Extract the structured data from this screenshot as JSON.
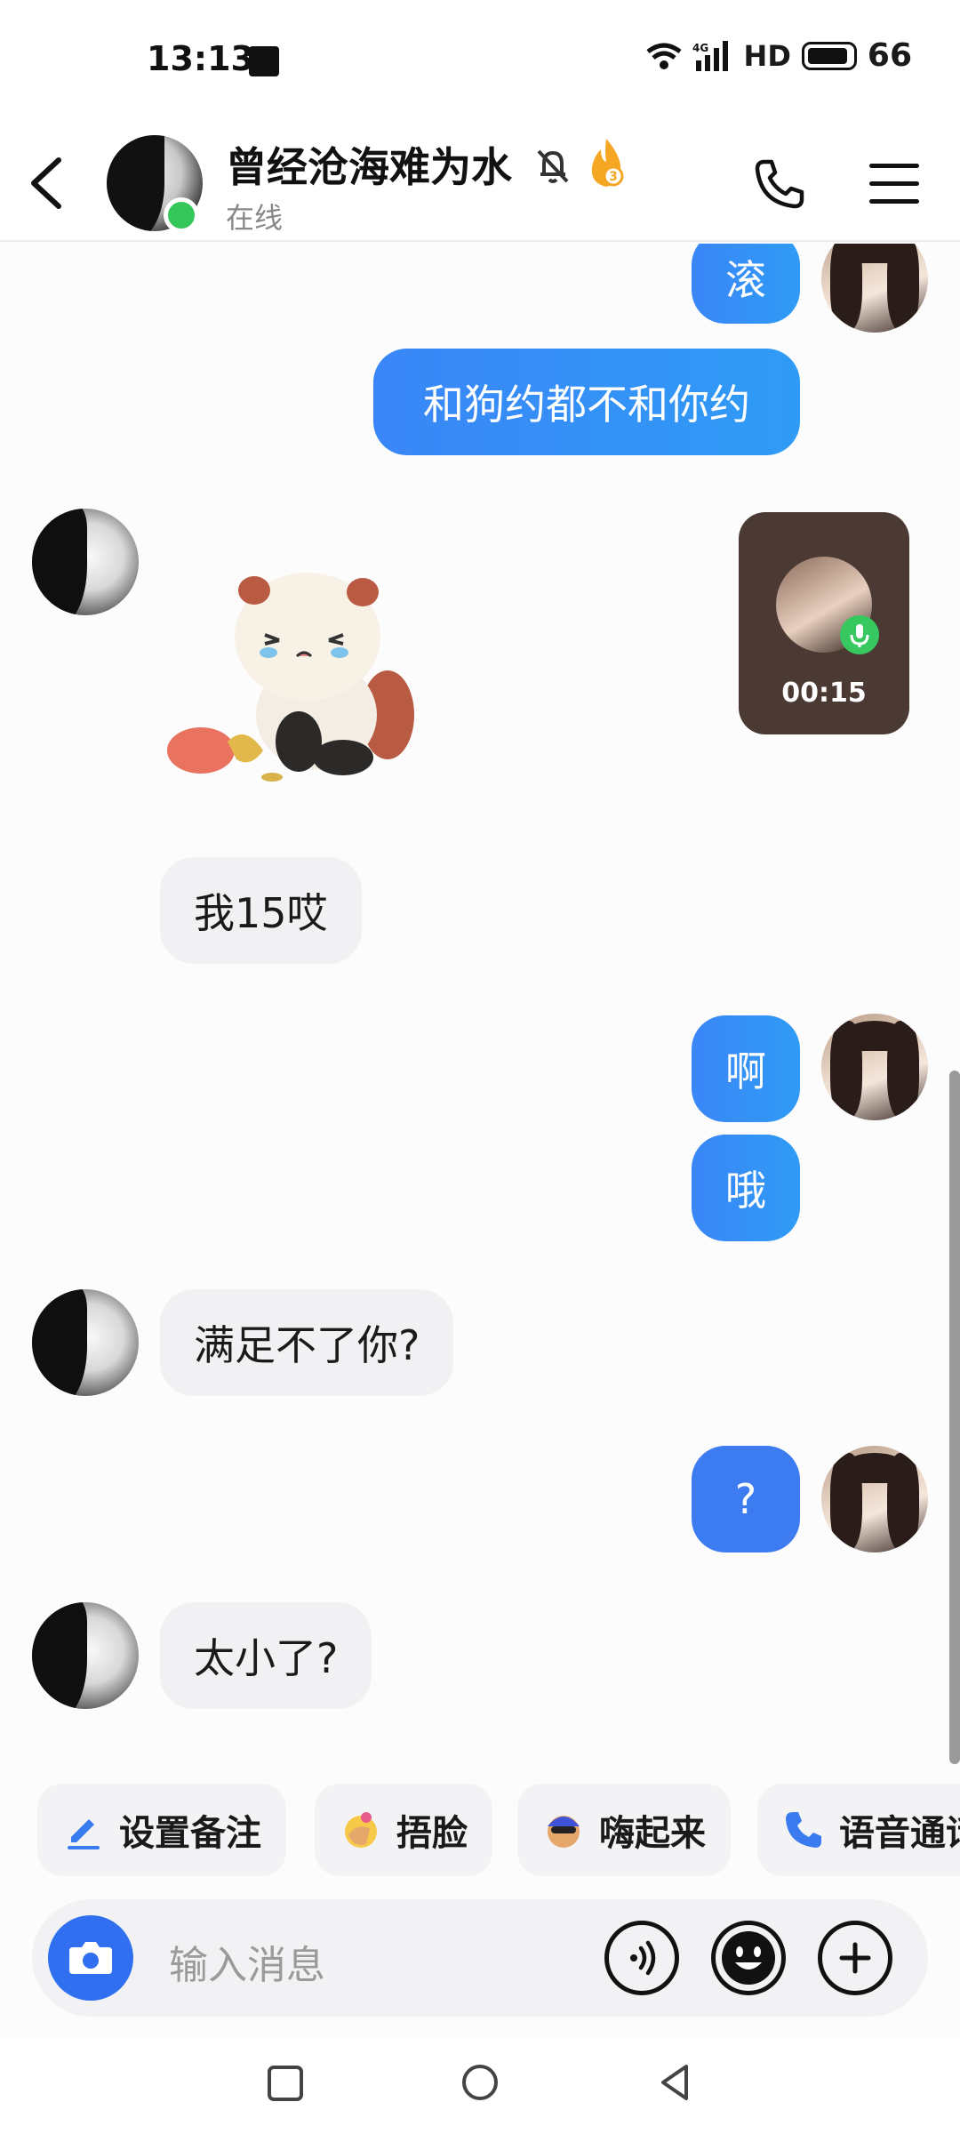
{
  "status_bar": {
    "time": "13:13",
    "network": "4G",
    "hd": "HD",
    "battery": "66"
  },
  "header": {
    "contact_name": "曾经沧海难为水",
    "status": "在线",
    "fire_level": "3"
  },
  "messages": [
    {
      "side": "me",
      "type": "text",
      "text": "滚"
    },
    {
      "side": "me",
      "type": "text",
      "text": "和狗约都不和你约"
    },
    {
      "side": "them",
      "type": "sticker",
      "text": ""
    },
    {
      "side": "me",
      "type": "call",
      "text": "00:15"
    },
    {
      "side": "them",
      "type": "text",
      "text": "我15哎"
    },
    {
      "side": "me",
      "type": "text",
      "text": "啊"
    },
    {
      "side": "me",
      "type": "text",
      "text": "哦"
    },
    {
      "side": "them",
      "type": "text",
      "text": "满足不了你?"
    },
    {
      "side": "me",
      "type": "text",
      "text": "?"
    },
    {
      "side": "them",
      "type": "text",
      "text": "太小了?"
    }
  ],
  "quick_actions": [
    {
      "label": "设置备注",
      "icon": "pencil-icon"
    },
    {
      "label": "捂脸",
      "icon": "facepalm-emoji-icon"
    },
    {
      "label": "嗨起来",
      "icon": "party-emoji-icon"
    },
    {
      "label": "语音通话",
      "icon": "phone-icon"
    }
  ],
  "input": {
    "placeholder": "输入消息"
  },
  "colors": {
    "my_bubble": "#3a86f7",
    "their_bubble": "#f1f1f3",
    "online": "#35c759",
    "camera_button": "#2f6ff0"
  }
}
